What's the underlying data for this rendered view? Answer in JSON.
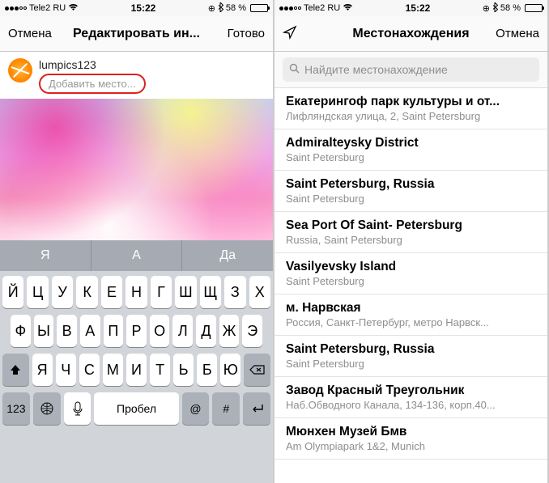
{
  "status": {
    "carrier": "Tele2 RU",
    "time": "15:22",
    "battery_pct": "58 %"
  },
  "left": {
    "nav": {
      "cancel": "Отмена",
      "title": "Редактировать ин...",
      "done": "Готово"
    },
    "username": "lumpics123",
    "add_location_label": "Добавить место...",
    "suggestions": [
      "Я",
      "А",
      "Да"
    ],
    "keyboard": {
      "row1": [
        "Й",
        "Ц",
        "У",
        "К",
        "Е",
        "Н",
        "Г",
        "Ш",
        "Щ",
        "З",
        "Х"
      ],
      "row2": [
        "Ф",
        "Ы",
        "В",
        "А",
        "П",
        "Р",
        "О",
        "Л",
        "Д",
        "Ж",
        "Э"
      ],
      "row3_shift": "⇧",
      "row3": [
        "Я",
        "Ч",
        "С",
        "М",
        "И",
        "Т",
        "Ь",
        "Б",
        "Ю"
      ],
      "row3_del": "⌫",
      "row4": {
        "num": "123",
        "globe": "🌐",
        "mic": "🎤",
        "space": "Пробел",
        "at": "@",
        "hash": "#",
        "return": "↵"
      }
    }
  },
  "right": {
    "nav": {
      "title": "Местонахождения",
      "cancel": "Отмена"
    },
    "search_placeholder": "Найдите местонахождение",
    "locations": [
      {
        "title": "Екатерингоф парк культуры и от...",
        "sub": "Лифляндская улица, 2, Saint Petersburg"
      },
      {
        "title": "Admiralteysky District",
        "sub": "Saint Petersburg"
      },
      {
        "title": "Saint Petersburg, Russia",
        "sub": "Saint Petersburg"
      },
      {
        "title": "Sea Port Of Saint- Petersburg",
        "sub": "Russia, Saint Petersburg"
      },
      {
        "title": "Vasilyevsky Island",
        "sub": "Saint Petersburg"
      },
      {
        "title": "м. Нарвская",
        "sub": "Россия, Санкт-Петербург, метро Нарвск..."
      },
      {
        "title": "Saint Petersburg, Russia",
        "sub": "Saint Petersburg"
      },
      {
        "title": "Завод Красный Треугольник",
        "sub": "Наб.Обводного Канала, 134-136, корп.40..."
      },
      {
        "title": "Мюнхен Музей Бмв",
        "sub": "Am Olympiapark 1&2, Munich"
      }
    ]
  }
}
